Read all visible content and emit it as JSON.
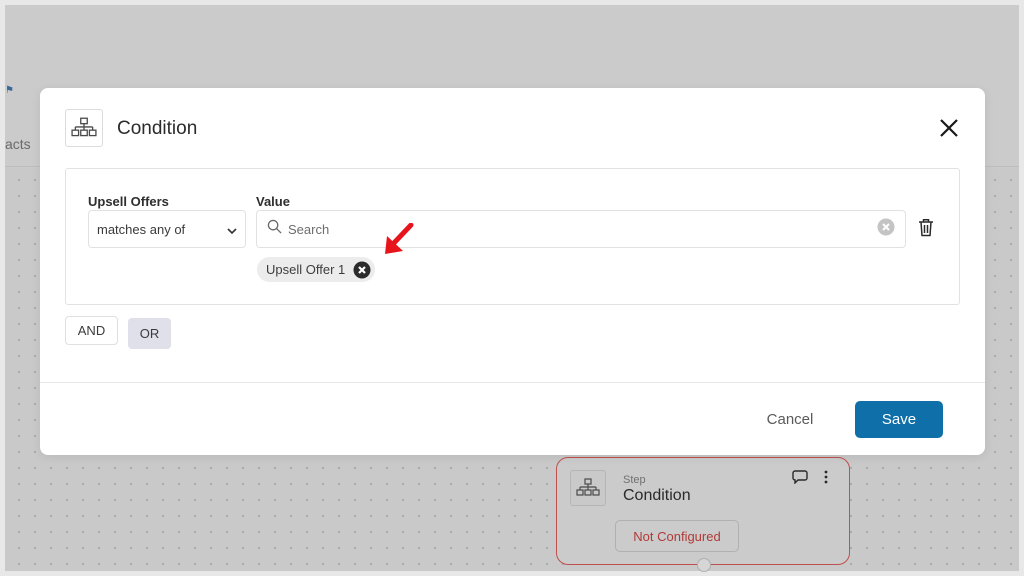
{
  "background": {
    "tab_text": "acts",
    "link_icon": "link-icon",
    "step_node": {
      "label": "Step",
      "title": "Condition",
      "status": "Not Configured",
      "icons": [
        "hierarchy-icon",
        "comment-icon",
        "more-vertical-icon"
      ]
    }
  },
  "modal": {
    "title": "Condition",
    "header_icon": "hierarchy-icon",
    "close_icon": "close-icon",
    "condition": {
      "field_label": "Upsell Offers",
      "operator": {
        "selected": "matches any of",
        "icon": "chevron-down-icon"
      },
      "value_label": "Value",
      "search": {
        "placeholder": "Search",
        "value": "",
        "icon": "search-icon",
        "clear_icon": "clear-circle-icon"
      },
      "delete_icon": "trash-icon",
      "selected_values": [
        {
          "label": "Upsell Offer 1",
          "remove_icon": "remove-circle-icon"
        }
      ]
    },
    "logic_buttons": {
      "and_label": "AND",
      "or_label": "OR"
    },
    "footer": {
      "cancel_label": "Cancel",
      "save_label": "Save"
    }
  },
  "annotation": {
    "arrow_icon": "red-arrow-icon",
    "arrow_color": "#e8141c"
  },
  "colors": {
    "primary": "#0f6fa8",
    "error": "#b03a37",
    "or_button_bg": "#dfe0ea"
  }
}
